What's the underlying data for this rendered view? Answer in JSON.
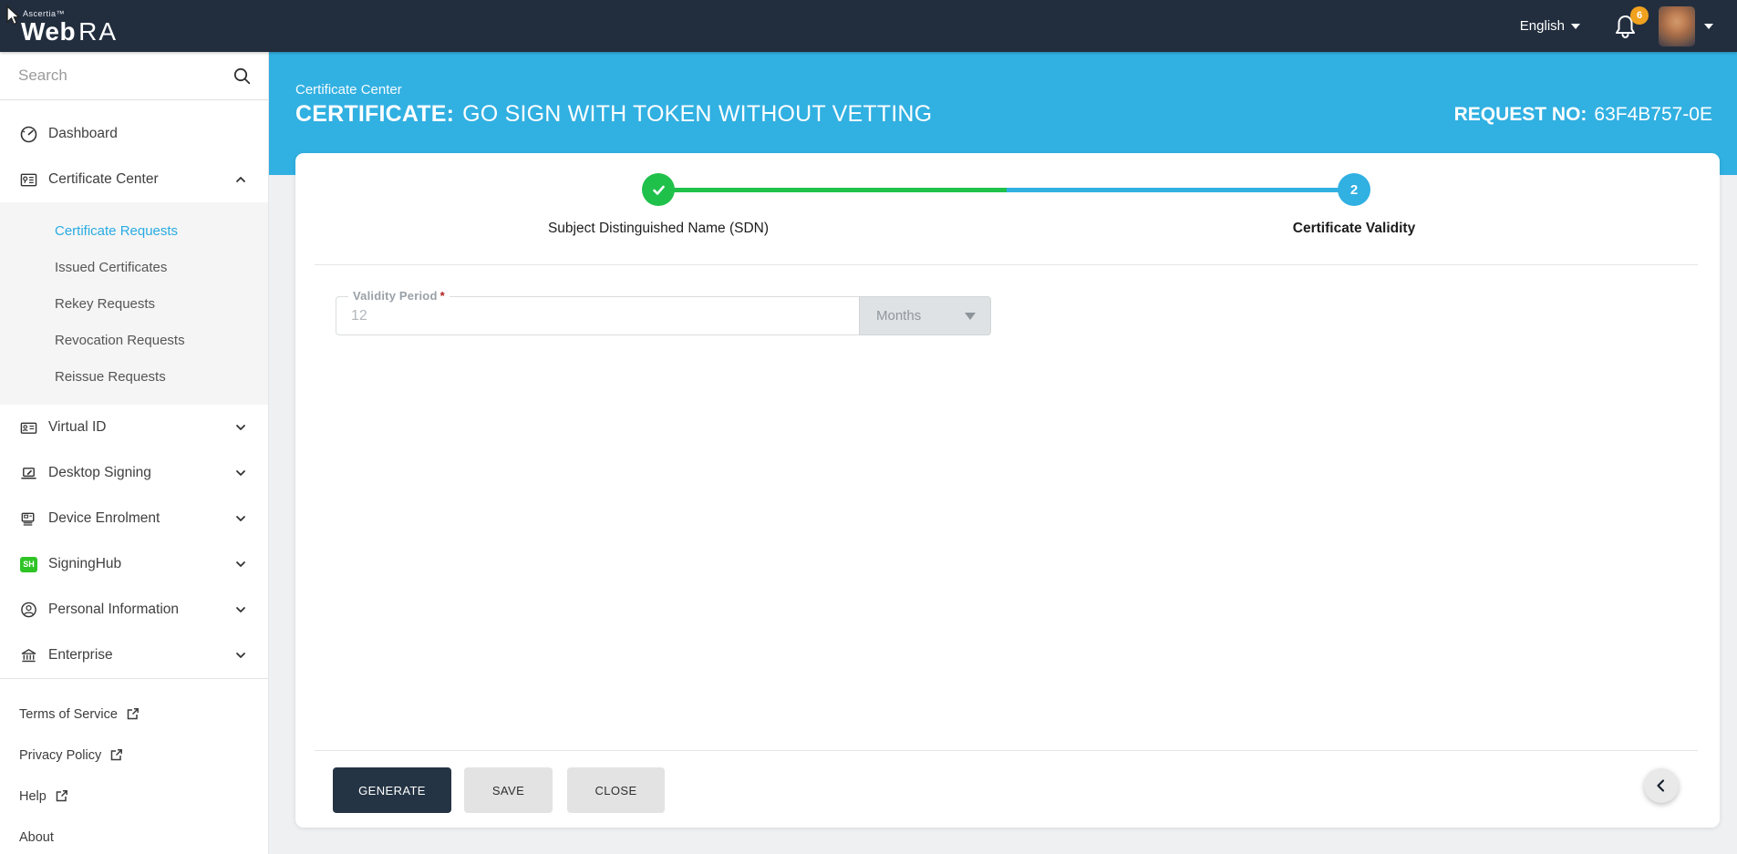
{
  "topbar": {
    "brand_super": "Ascertia™",
    "brand_web": "Web",
    "brand_ra": "RA",
    "language_label": "English",
    "notification_count": "6"
  },
  "sidebar": {
    "search_placeholder": "Search",
    "items": [
      {
        "label": "Dashboard",
        "icon": "dashboard-gauge-icon",
        "expandable": false
      },
      {
        "label": "Certificate Center",
        "icon": "certificate-icon",
        "expandable": true,
        "expanded": true,
        "children": [
          {
            "label": "Certificate Requests",
            "active": true
          },
          {
            "label": "Issued Certificates",
            "active": false
          },
          {
            "label": "Rekey Requests",
            "active": false
          },
          {
            "label": "Revocation Requests",
            "active": false
          },
          {
            "label": "Reissue Requests",
            "active": false
          }
        ]
      },
      {
        "label": "Virtual ID",
        "icon": "virtual-id-card-icon",
        "expandable": true
      },
      {
        "label": "Desktop Signing",
        "icon": "desktop-signing-icon",
        "expandable": true
      },
      {
        "label": "Device Enrolment",
        "icon": "device-enrolment-icon",
        "expandable": true
      },
      {
        "label": "SigningHub",
        "icon": "signinghub-icon",
        "icon_text": "SH",
        "expandable": true
      },
      {
        "label": "Personal Information",
        "icon": "person-circle-icon",
        "expandable": true
      },
      {
        "label": "Enterprise",
        "icon": "enterprise-bank-icon",
        "expandable": true
      }
    ],
    "footer_links": [
      {
        "label": "Terms of Service",
        "external": true
      },
      {
        "label": "Privacy Policy",
        "external": true
      },
      {
        "label": "Help",
        "external": true
      },
      {
        "label": "About",
        "external": false
      }
    ]
  },
  "header": {
    "breadcrumb": "Certificate Center",
    "title_prefix": "CERTIFICATE:",
    "title_rest": "GO SIGN WITH TOKEN WITHOUT VETTING",
    "request_label": "REQUEST NO:",
    "request_value": "63F4B757-0E"
  },
  "stepper": {
    "steps": [
      {
        "label": "Subject Distinguished Name (SDN)",
        "state": "complete"
      },
      {
        "label": "Certificate Validity",
        "state": "active",
        "number": "2"
      }
    ]
  },
  "form": {
    "validity_label": "Validity Period",
    "required_marker": "*",
    "validity_value": "12",
    "unit_value": "Months"
  },
  "actions": {
    "generate": "GENERATE",
    "save": "SAVE",
    "close": "CLOSE"
  },
  "colors": {
    "topbar": "#222e3e",
    "accent": "#31b0e2",
    "accentActive": "#29abe2",
    "success": "#1fc14b",
    "badge": "#f0a11e",
    "signinghub": "#2fc426",
    "darkBtn": "#253444"
  }
}
